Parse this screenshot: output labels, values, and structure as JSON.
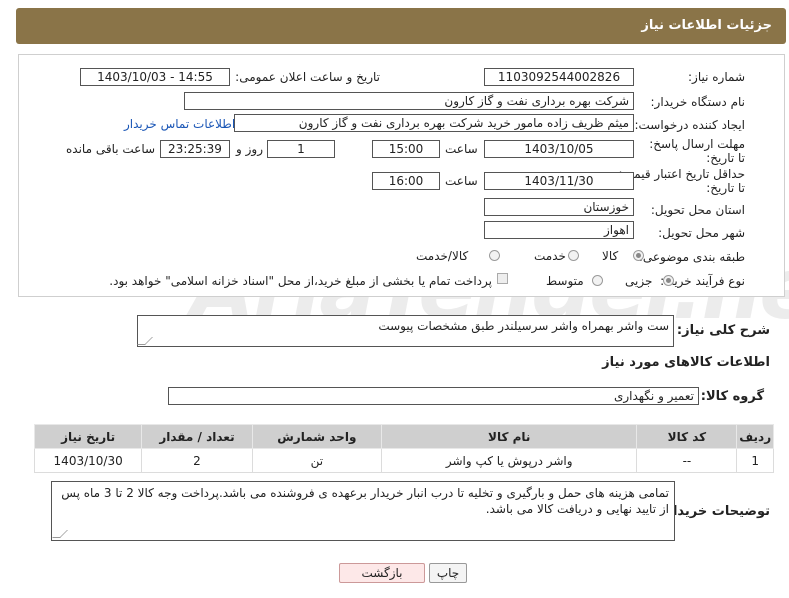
{
  "header": {
    "title": "جزئیات اطلاعات نیاز"
  },
  "watermark": {
    "text": "AriaTender.neT"
  },
  "form": {
    "need_number": {
      "label": "شماره نیاز:",
      "value": "1103092544002826"
    },
    "announce": {
      "label": "تاریخ و ساعت اعلان عمومی:",
      "value": "1403/10/03 - 14:55"
    },
    "buyer_org": {
      "label": "نام دستگاه خریدار:",
      "value": "شرکت بهره برداری نفت و گاز کارون"
    },
    "requester": {
      "label": "ایجاد کننده درخواست:",
      "value": "میثم ظریف زاده مامور خرید شرکت بهره برداری نفت و گاز کارون",
      "contact_link": "اطلاعات تماس خریدار"
    },
    "reply_deadline": {
      "label": "مهلت ارسال پاسخ: تا تاریخ:",
      "date": "1403/10/05",
      "time_label": "ساعت",
      "time": "15:00",
      "days": "1",
      "days_label": "روز و",
      "remaining": "23:25:39",
      "remaining_label": "ساعت باقی مانده"
    },
    "price_validity": {
      "label": "حداقل تاریخ اعتبار قیمت: تا تاریخ:",
      "date": "1403/11/30",
      "time_label": "ساعت",
      "time": "16:00"
    },
    "province": {
      "label": "استان محل تحویل:",
      "value": "خوزستان"
    },
    "city": {
      "label": "شهر محل تحویل:",
      "value": "اهواز"
    },
    "category": {
      "label": "طبقه بندی موضوعی:",
      "options": [
        "کالا",
        "خدمت",
        "کالا/خدمت"
      ],
      "selected": "کالا"
    },
    "purchase_type": {
      "label": "نوع فرآیند خرید :",
      "options": [
        "جزیی",
        "متوسط"
      ],
      "selected": "جزیی",
      "note": "پرداخت تمام یا بخشی از مبلغ خرید،از محل \"اسناد خزانه اسلامی\" خواهد بود."
    }
  },
  "description": {
    "label": "شرح کلی نیاز:",
    "value": "ست واشر بهمراه واشر سرسیلندر طبق مشخصات پیوست"
  },
  "goods_section": {
    "title": "اطلاعات کالاهای مورد نیاز"
  },
  "goods_group": {
    "label": "گروه کالا:",
    "value": "تعمیر و نگهداری"
  },
  "table": {
    "headers": [
      "ردیف",
      "کد کالا",
      "نام کالا",
      "واحد شمارش",
      "تعداد / مقدار",
      "تاریخ نیاز"
    ],
    "rows": [
      [
        "1",
        "--",
        "واشر درپوش یا کپ واشر",
        "تن",
        "2",
        "1403/10/30"
      ]
    ]
  },
  "buyer_notes": {
    "label": "توضیحات خریدار:",
    "value": "تمامی هزینه های حمل و بارگیری و تخلیه تا درب انبار خریدار برعهده ی فروشنده می باشد.پرداخت وجه کالا 2 تا 3 ماه پس از تایید نهایی و دریافت کالا می باشد."
  },
  "buttons": {
    "print": "چاپ",
    "back": "بازگشت"
  },
  "colors": {
    "header_bg": "#8a7448",
    "table_header": "#cfcfcf",
    "back_button_bg": "#fde8e8",
    "link": "#1a56b6"
  }
}
